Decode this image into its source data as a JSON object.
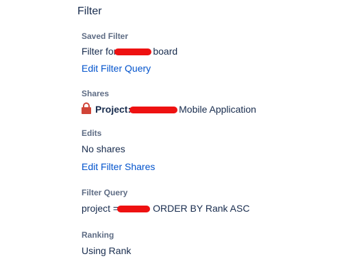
{
  "panel": {
    "title": "Filter"
  },
  "saved_filter": {
    "label": "Saved Filter",
    "value_prefix": "Filter for",
    "value_suffix": "board",
    "edit_link": "Edit Filter Query"
  },
  "shares": {
    "label": "Shares",
    "project_label": "Project:",
    "project_suffix": "Mobile Application"
  },
  "edits": {
    "label": "Edits",
    "value": "No shares",
    "edit_link": "Edit Filter Shares"
  },
  "filter_query": {
    "label": "Filter Query",
    "prefix": "project =",
    "suffix": "ORDER BY Rank ASC"
  },
  "ranking": {
    "label": "Ranking",
    "value": "Using Rank"
  },
  "colors": {
    "link": "#0052cc",
    "text": "#172b4d",
    "label": "#5e6c84",
    "redaction": "#ee1111",
    "lock": "#d04437"
  }
}
